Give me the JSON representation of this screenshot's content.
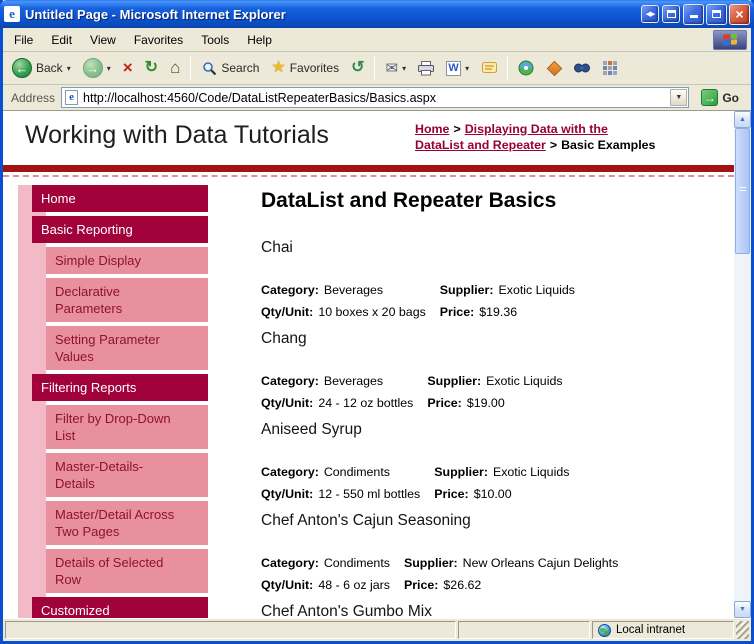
{
  "window": {
    "title": "Untitled Page - Microsoft Internet Explorer"
  },
  "menu": {
    "items": [
      "File",
      "Edit",
      "View",
      "Favorites",
      "Tools",
      "Help"
    ]
  },
  "toolbar": {
    "back": "Back",
    "search": "Search",
    "favorites": "Favorites"
  },
  "address": {
    "label": "Address",
    "url": "http://localhost:4560/Code/DataListRepeaterBasics/Basics.aspx",
    "go": "Go"
  },
  "header": {
    "site_title": "Working with Data Tutorials",
    "breadcrumb": {
      "home": "Home",
      "sep": ">",
      "section_line1": "Displaying Data with the",
      "section_line2": "DataList and Repeater",
      "current": "Basic Examples"
    }
  },
  "sidebar": {
    "items": [
      {
        "label": "Home",
        "type": "section"
      },
      {
        "label": "Basic Reporting",
        "type": "section"
      },
      {
        "label": "Simple Display",
        "type": "sub"
      },
      {
        "label": "Declarative Parameters",
        "type": "sub"
      },
      {
        "label": "Setting Parameter Values",
        "type": "sub"
      },
      {
        "label": "Filtering Reports",
        "type": "section"
      },
      {
        "label": "Filter by Drop-Down List",
        "type": "sub"
      },
      {
        "label": "Master-Details-Details",
        "type": "sub"
      },
      {
        "label": "Master/Detail Across Two Pages",
        "type": "sub"
      },
      {
        "label": "Details of Selected Row",
        "type": "sub"
      },
      {
        "label": "Customized Formatting",
        "type": "section"
      }
    ]
  },
  "main": {
    "title": "DataList and Repeater Basics",
    "labels": {
      "category": "Category:",
      "supplier": "Supplier:",
      "qty": "Qty/Unit:",
      "price": "Price:"
    },
    "products": [
      {
        "name": "Chai",
        "category": "Beverages",
        "supplier": "Exotic Liquids",
        "qty": "10 boxes x 20 bags",
        "price": "$19.36"
      },
      {
        "name": "Chang",
        "category": "Beverages",
        "supplier": "Exotic Liquids",
        "qty": "24 - 12 oz bottles",
        "price": "$19.00"
      },
      {
        "name": "Aniseed Syrup",
        "category": "Condiments",
        "supplier": "Exotic Liquids",
        "qty": "12 - 550 ml bottles",
        "price": "$10.00"
      },
      {
        "name": "Chef Anton's Cajun Seasoning",
        "category": "Condiments",
        "supplier": "New Orleans Cajun Delights",
        "qty": "48 - 6 oz jars",
        "price": "$26.62"
      },
      {
        "name": "Chef Anton's Gumbo Mix"
      }
    ]
  },
  "statusbar": {
    "zone": "Local intranet"
  },
  "icons": {
    "ie_logo": "e",
    "window_pair": "◀▶",
    "close": "×",
    "back_arrow": "←",
    "forward_arrow": "→",
    "dropdown": "▾",
    "stop": "×",
    "refresh": "↻",
    "home": "⌂",
    "favorites_star": "★",
    "history": "↺",
    "mail": "✉",
    "word": "W",
    "address_dropdown": "▼",
    "go_arrow": "→",
    "scroll_up": "▲",
    "scroll_down": "▼"
  },
  "colors": {
    "titlebar_blue": "#0C52CE",
    "chrome_beige": "#ECE9D8",
    "nav_dark_red": "#A00239",
    "nav_pink": "#E9909F",
    "nav_strip_pink": "#F2B9C6",
    "band_red": "#A31313",
    "link_maroon": "#990033",
    "go_green": "#2F9E3F"
  }
}
